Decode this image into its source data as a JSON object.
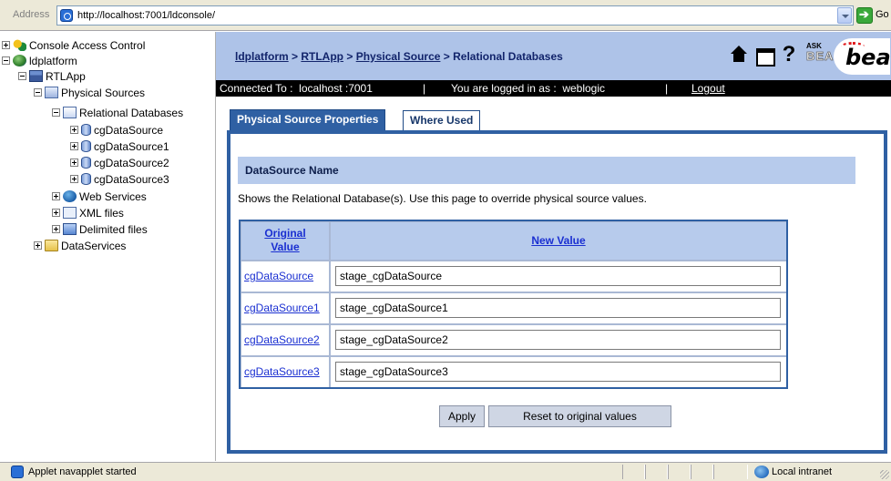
{
  "browser": {
    "address_label": "Address",
    "url": "http://localhost:7001/ldconsole/",
    "go_label": "Go"
  },
  "tree": {
    "items": [
      {
        "label": "Console Access Control",
        "icon": "keys-icon",
        "toggle": "plus"
      },
      {
        "label": "ldplatform",
        "icon": "globe-icon",
        "toggle": "minus"
      },
      {
        "label": "RTLApp",
        "icon": "application-icon",
        "toggle": "minus"
      },
      {
        "label": "Physical Sources",
        "icon": "physical-sources-icon",
        "toggle": "minus"
      },
      {
        "label": "Relational Databases",
        "icon": "relational-databases-icon",
        "toggle": "minus"
      },
      {
        "label": "cgDataSource",
        "icon": "database-icon",
        "toggle": "plus"
      },
      {
        "label": "cgDataSource1",
        "icon": "database-icon",
        "toggle": "plus"
      },
      {
        "label": "cgDataSource2",
        "icon": "database-icon",
        "toggle": "plus"
      },
      {
        "label": "cgDataSource3",
        "icon": "database-icon",
        "toggle": "plus"
      },
      {
        "label": "Web Services",
        "icon": "web-services-icon",
        "toggle": "plus"
      },
      {
        "label": "XML files",
        "icon": "xml-files-icon",
        "toggle": "plus"
      },
      {
        "label": "Delimited files",
        "icon": "delimited-files-icon",
        "toggle": "plus"
      },
      {
        "label": "DataServices",
        "icon": "folder-icon",
        "toggle": "plus"
      }
    ]
  },
  "header": {
    "crumb_1": "ldplatform",
    "sep": " > ",
    "crumb_2": "RTLApp",
    "crumb_3": "Physical Source",
    "crumb_4": "Relational Databases",
    "help_glyph": "?",
    "ask_label": "ASK",
    "bea_small_label": "BEA",
    "logo_label": "bea"
  },
  "session": {
    "connected": "Connected To :  localhost :7001",
    "divider": "|",
    "logged_in": "You are logged in as :  weblogic",
    "logout": "Logout"
  },
  "tabs": {
    "active": "Physical Source Properties",
    "inactive": "Where Used"
  },
  "section": {
    "title": "DataSource Name",
    "description": "Shows the Relational Database(s). Use this page to override physical source values."
  },
  "table": {
    "col_original_line1": "Original",
    "col_original_line2": "Value",
    "col_new": "New Value",
    "rows": [
      {
        "original": "cgDataSource",
        "new_value": "stage_cgDataSource"
      },
      {
        "original": "cgDataSource1",
        "new_value": "stage_cgDataSource1"
      },
      {
        "original": "cgDataSource2",
        "new_value": "stage_cgDataSource2"
      },
      {
        "original": "cgDataSource3",
        "new_value": "stage_cgDataSource3"
      }
    ]
  },
  "buttons": {
    "apply": "Apply",
    "reset": "Reset to original values"
  },
  "statusbar": {
    "message": "Applet navapplet started",
    "zone": "Local intranet"
  },
  "colors": {
    "header_bg": "#aec3e8",
    "tab_active": "#2f60a3",
    "link": "#1a2fd1",
    "section_bg": "#b7cbec"
  }
}
